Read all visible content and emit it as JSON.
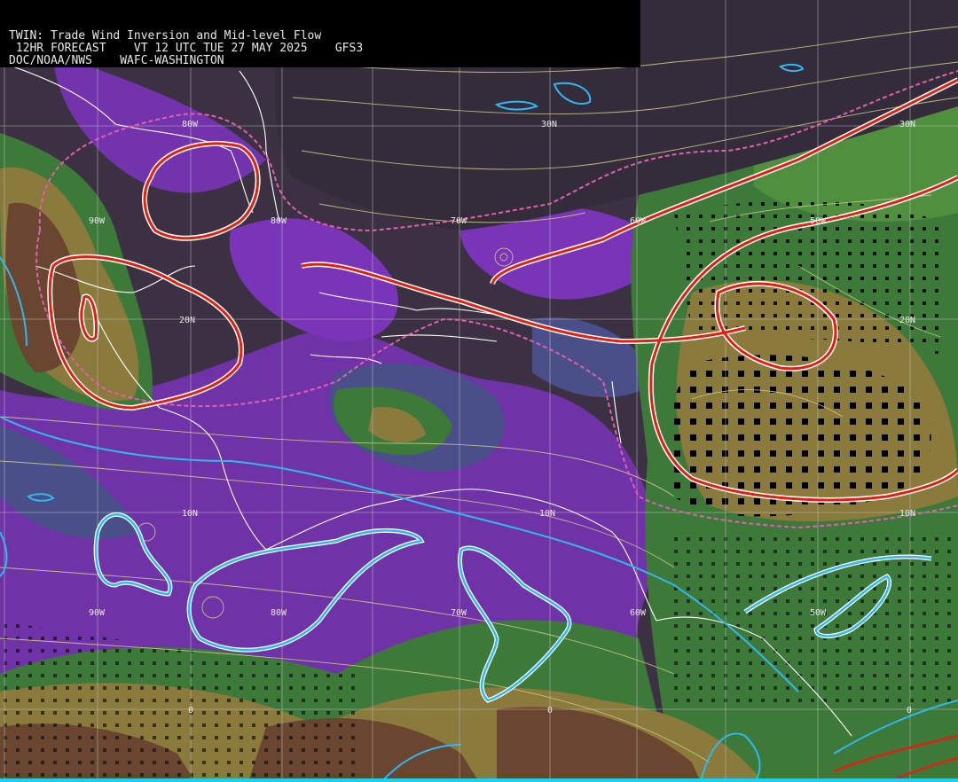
{
  "header": {
    "line1": "TWIN: Trade Wind Inversion and Mid-level Flow",
    "line2": " 12HR FORECAST    VT 12 UTC TUE 27 MAY 2025    GFS3",
    "line3": "DOC/NOAA/NWS    WAFC-WASHINGTON"
  },
  "grid_labels": {
    "lon_90w": "90W",
    "lon_80w": "80W",
    "lon_70w": "70W",
    "lon_60w": "60W",
    "lon_50w": "50W",
    "lat_30n": "30N",
    "lat_20n": "20N",
    "lat_10n": "10N",
    "lat_0": "0"
  },
  "colors": {
    "background_shade": "#3b3142",
    "purple": "#7a34b8",
    "slate_blue": "#4a4f8a",
    "green": "#3d7a3a",
    "bright_green": "#4f8f3e",
    "olive": "#8a7a3c",
    "brown": "#6a4530",
    "inversion_contour": "#e02010",
    "dashed_contour": "#e060b0",
    "cyan_contour": "#30b8f0",
    "streamlines": "#d8cf8a",
    "coastline": "#ffffff"
  }
}
